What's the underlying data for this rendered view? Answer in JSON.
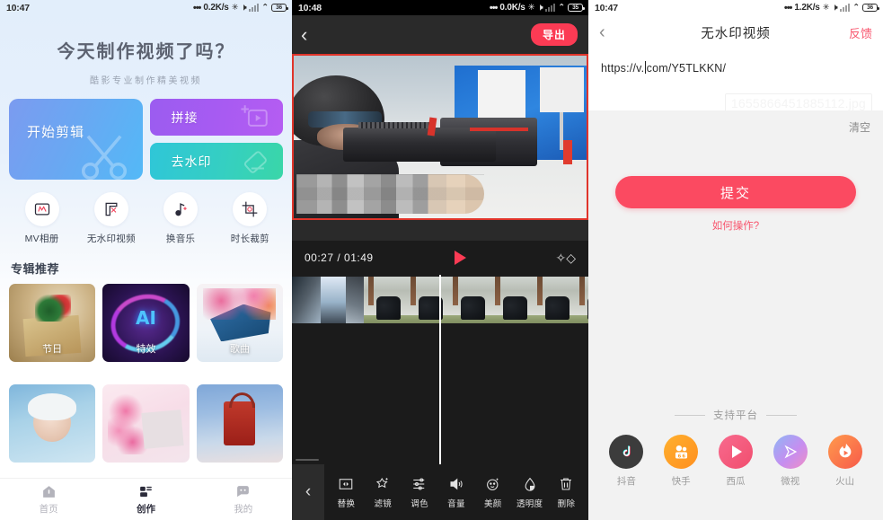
{
  "home": {
    "status": {
      "time": "10:47",
      "speed": "0.2K/s",
      "battery": "36"
    },
    "hero": {
      "title": "今天制作视频了吗？",
      "subtitle": "酷影专业制作精美视频"
    },
    "tiles": [
      {
        "label": "开始剪辑",
        "icon": "scissors-icon"
      },
      {
        "label": "拼接",
        "icon": "splice-icon"
      },
      {
        "label": "去水印",
        "icon": "eraser-icon"
      }
    ],
    "quick_actions": [
      {
        "label": "MV相册",
        "icon": "mv-album-icon"
      },
      {
        "label": "无水印视频",
        "icon": "no-watermark-icon"
      },
      {
        "label": "换音乐",
        "icon": "music-note-icon"
      },
      {
        "label": "时长裁剪",
        "icon": "crop-duration-icon"
      }
    ],
    "section_title": "专辑推荐",
    "albums": [
      {
        "name": "节日",
        "art": "art-holiday"
      },
      {
        "name": "特效",
        "art": "art-ai"
      },
      {
        "name": "歌曲",
        "art": "art-piano"
      },
      {
        "name": "",
        "art": "art-baby"
      },
      {
        "name": "",
        "art": "art-flower"
      },
      {
        "name": "",
        "art": "art-lantern"
      }
    ],
    "tabs": [
      {
        "label": "首页",
        "icon": "home-icon",
        "active": false
      },
      {
        "label": "创作",
        "icon": "create-icon",
        "active": true
      },
      {
        "label": "我的",
        "icon": "profile-icon",
        "active": false
      }
    ]
  },
  "editor": {
    "status": {
      "time": "10:48",
      "speed": "0.0K/s",
      "battery": "35"
    },
    "topbar": {
      "back_icon": "chevron-left-icon",
      "export_label": "导出"
    },
    "player": {
      "current_time": "00:27",
      "total_time": "01:49",
      "time_display": "00:27 / 01:49",
      "play_icon": "play-icon",
      "effects_icon": "sparkle-diamond-icon"
    },
    "tools": [
      {
        "label": "替换",
        "icon": "replace-icon"
      },
      {
        "label": "滤镜",
        "icon": "filter-icon"
      },
      {
        "label": "调色",
        "icon": "color-adjust-icon"
      },
      {
        "label": "音量",
        "icon": "volume-icon"
      },
      {
        "label": "美颜",
        "icon": "beauty-icon"
      },
      {
        "label": "透明度",
        "icon": "opacity-icon"
      },
      {
        "label": "删除",
        "icon": "trash-icon"
      }
    ],
    "collapse_icon": "chevron-left-icon"
  },
  "watermark": {
    "status": {
      "time": "10:47",
      "speed": "1.2K/s",
      "battery": "36"
    },
    "topbar": {
      "back_icon": "chevron-left-icon",
      "title": "无水印视频",
      "feedback_label": "反馈"
    },
    "url_input": {
      "value_before_caret": "https://v.",
      "value_after_caret": "com/Y5TLKKN/",
      "full_value": "https://v.com/Y5TLKKN/"
    },
    "ghost_filename": "1655866451885112.jpg",
    "clear_label": "清空",
    "submit_label": "提交",
    "how_to_label": "如何操作?",
    "platforms_title": "支持平台",
    "platforms": [
      {
        "name": "抖音",
        "icon": "douyin-icon"
      },
      {
        "name": "快手",
        "icon": "kuaishou-icon"
      },
      {
        "name": "西瓜",
        "icon": "xigua-icon"
      },
      {
        "name": "微视",
        "icon": "weishi-icon"
      },
      {
        "name": "火山",
        "icon": "huoshan-icon"
      }
    ]
  },
  "colors": {
    "accent_red": "#fb3b54",
    "submit_red": "#fb4a61",
    "edit_blue": "#6aa7f2",
    "splice_purple": "#a85bf2",
    "watermark_teal": "#35cfc2"
  }
}
